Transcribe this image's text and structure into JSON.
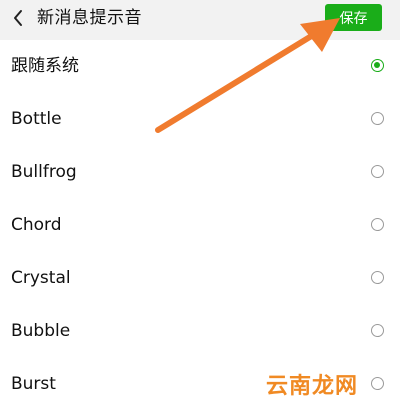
{
  "header": {
    "back_icon": "chevron-left-icon",
    "title": "新消息提示音",
    "save_label": "保存",
    "save_color": "#1aad19"
  },
  "sounds": [
    {
      "label": "跟随系统",
      "selected": true
    },
    {
      "label": "Bottle",
      "selected": false
    },
    {
      "label": "Bullfrog",
      "selected": false
    },
    {
      "label": "Chord",
      "selected": false
    },
    {
      "label": "Crystal",
      "selected": false
    },
    {
      "label": "Bubble",
      "selected": false
    },
    {
      "label": "Burst",
      "selected": false
    }
  ],
  "annotation": {
    "arrow_color": "#f07b2e",
    "watermark": "云南龙网"
  }
}
